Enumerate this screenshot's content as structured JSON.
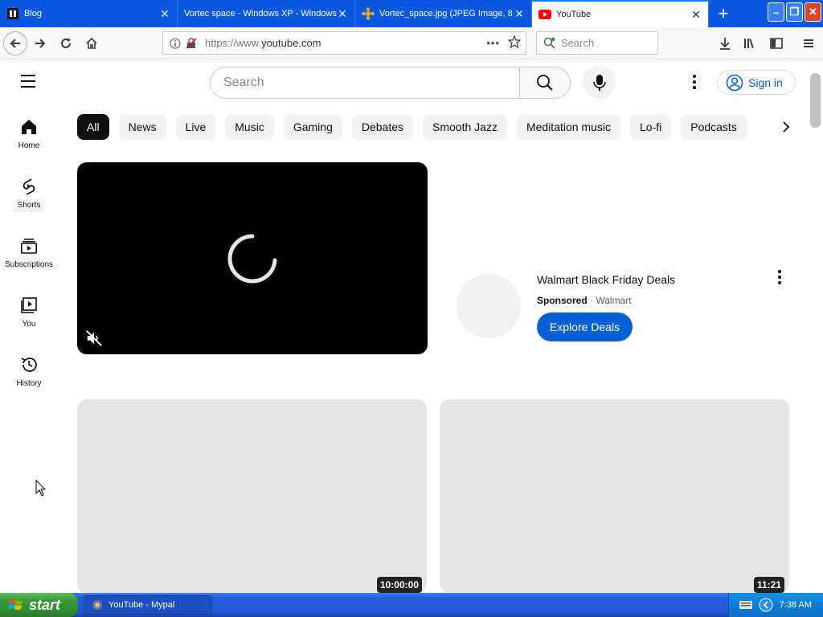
{
  "browser": {
    "tabs": [
      {
        "title": "Blog",
        "icon": "blog-favicon"
      },
      {
        "title": "Vortec space - Windows XP - Windows",
        "icon": "page-favicon"
      },
      {
        "title": "Vortec_space.jpg (JPEG Image, 8",
        "icon": "image-favicon"
      },
      {
        "title": "YouTube",
        "icon": "youtube-favicon",
        "active": true
      }
    ],
    "url_prefix": "https://www.",
    "url_domain": "youtube.com",
    "search_placeholder": "Search"
  },
  "youtube": {
    "search_placeholder": "Search",
    "signin_label": "Sign in",
    "sidebar": [
      {
        "label": "Home",
        "icon": "home-icon"
      },
      {
        "label": "Shorts",
        "icon": "shorts-icon"
      },
      {
        "label": "Subscriptions",
        "icon": "subscriptions-icon"
      },
      {
        "label": "You",
        "icon": "you-icon"
      },
      {
        "label": "History",
        "icon": "history-icon"
      }
    ],
    "chips": [
      "All",
      "News",
      "Live",
      "Music",
      "Gaming",
      "Debates",
      "Smooth Jazz",
      "Meditation music",
      "Lo-fi",
      "Podcasts"
    ],
    "ad": {
      "title": "Walmart Black Friday Deals",
      "sponsored": "Sponsored",
      "separator": "·",
      "advertiser": "Walmart",
      "cta": "Explore Deals"
    },
    "videos": [
      {
        "duration": "10:00:00"
      },
      {
        "duration": "11:21"
      }
    ],
    "accent": "#065fd4"
  },
  "taskbar": {
    "start_label": "start",
    "task_item": "YouTube - Mypal",
    "clock": "7:38 AM"
  }
}
